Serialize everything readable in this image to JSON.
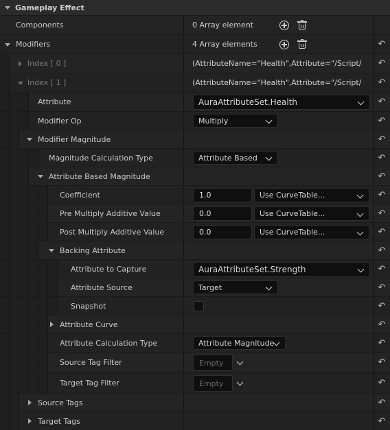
{
  "section": {
    "title": "Gameplay Effect"
  },
  "components": {
    "label": "Components",
    "value": "0 Array element"
  },
  "modifiers": {
    "label": "Modifiers",
    "value": "4 Array elements"
  },
  "index0": {
    "label": "Index [ 0 ]",
    "value": "(AttributeName=\"Health\",Attribute=\"/Script/"
  },
  "index1": {
    "label": "Index [ 1 ]",
    "value": "(AttributeName=\"Health\",Attribute=\"/Script/"
  },
  "attribute": {
    "label": "Attribute",
    "value": "AuraAttributeSet.Health"
  },
  "modifier_op": {
    "label": "Modifier Op",
    "value": "Multiply"
  },
  "modifier_magnitude": {
    "label": "Modifier Magnitude"
  },
  "magnitude_calc_type": {
    "label": "Magnitude Calculation Type",
    "value": "Attribute Based"
  },
  "attribute_based_magnitude": {
    "label": "Attribute Based Magnitude"
  },
  "coefficient": {
    "label": "Coefficient",
    "value": "1.0",
    "curve": "Use CurveTable..."
  },
  "pre_multiply": {
    "label": "Pre Multiply Additive Value",
    "value": "0.0",
    "curve": "Use CurveTable..."
  },
  "post_multiply": {
    "label": "Post Multiply Additive Value",
    "value": "0.0",
    "curve": "Use CurveTable..."
  },
  "backing_attribute": {
    "label": "Backing Attribute"
  },
  "attribute_to_capture": {
    "label": "Attribute to Capture",
    "value": "AuraAttributeSet.Strength"
  },
  "attribute_source": {
    "label": "Attribute Source",
    "value": "Target"
  },
  "snapshot": {
    "label": "Snapshot",
    "checked": false
  },
  "attribute_curve": {
    "label": "Attribute Curve"
  },
  "attribute_calc_type": {
    "label": "Attribute Calculation Type",
    "value": "Attribute Magnitude"
  },
  "source_tag_filter": {
    "label": "Source Tag Filter",
    "value": "Empty"
  },
  "target_tag_filter": {
    "label": "Target Tag Filter",
    "value": "Empty"
  },
  "source_tags": {
    "label": "Source Tags"
  },
  "target_tags": {
    "label": "Target Tags"
  },
  "icons": {
    "reset": "reset-to-default-icon",
    "add": "add-element-icon",
    "delete": "delete-all-icon"
  },
  "colors": {
    "background": "#1a1a1a",
    "row": "#242424",
    "category": "#2b2b2b",
    "field": "#0f0f0f"
  }
}
